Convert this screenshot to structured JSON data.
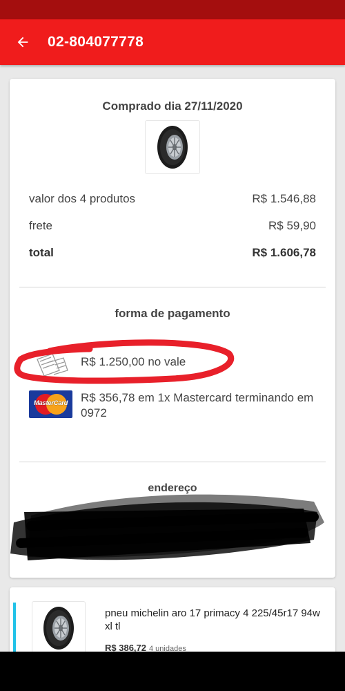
{
  "header": {
    "title": "02-804077778",
    "back_icon": "arrow-left-icon"
  },
  "order": {
    "purchase_date": "Comprado dia 27/11/2020",
    "summary": {
      "products_label": "valor dos 4 produtos",
      "products_value": "R$ 1.546,88",
      "shipping_label": "frete",
      "shipping_value": "R$ 59,90",
      "total_label": "total",
      "total_value": "R$ 1.606,78"
    }
  },
  "payment": {
    "title": "forma de pagamento",
    "methods": [
      {
        "icon": "voucher-icon",
        "text": "R$ 1.250,00 no vale"
      },
      {
        "icon": "mastercard-icon",
        "brand": "MasterCard",
        "text": "R$ 356,78 em 1x Mastercard terminando em 0972"
      }
    ]
  },
  "address": {
    "title": "endereço"
  },
  "items": [
    {
      "name": "pneu michelin aro 17 primacy 4 225/45r17 94w xl tl",
      "price": "R$ 386,72",
      "units": "4 unidades"
    }
  ],
  "colors": {
    "appbar": "#f01c1c",
    "statusbar": "#a40e0e",
    "annotation": "#e8202a",
    "item_accent": "#21c2e8"
  }
}
